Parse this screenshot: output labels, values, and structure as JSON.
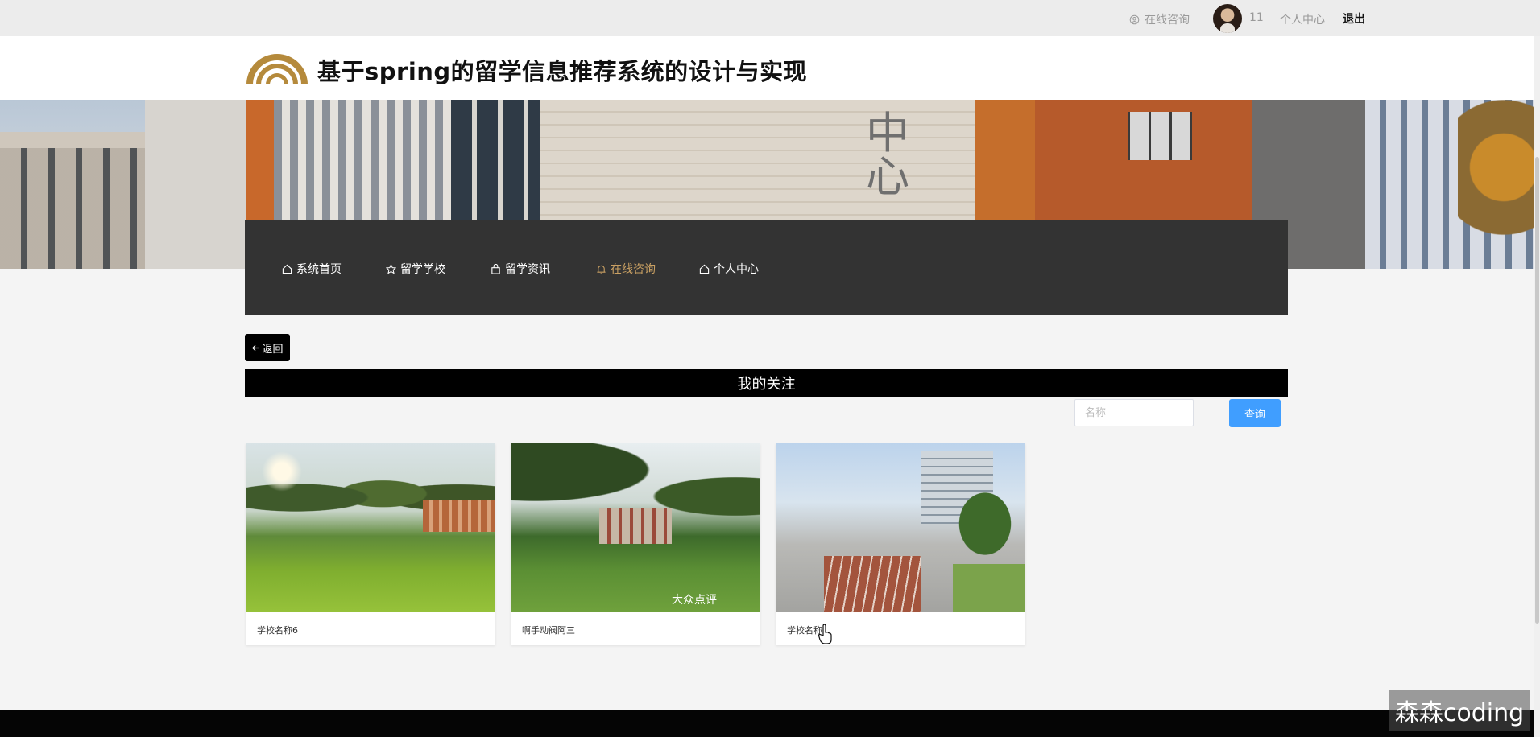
{
  "topbar": {
    "consult_label": "在线咨询",
    "username": "11",
    "center_label": "个人中心",
    "logout_label": "退出"
  },
  "header": {
    "title": "基于spring的留学信息推荐系统的设计与实现"
  },
  "nav": {
    "items": [
      {
        "label": "系统首页",
        "icon": "home-icon"
      },
      {
        "label": "留学学校",
        "icon": "star-icon"
      },
      {
        "label": "留学资讯",
        "icon": "bag-icon"
      },
      {
        "label": "在线咨询",
        "icon": "bell-icon",
        "active": true
      },
      {
        "label": "个人中心",
        "icon": "home-icon"
      }
    ],
    "active_color": "#c9a063"
  },
  "page": {
    "back_label": "返回",
    "section_title": "我的关注"
  },
  "search": {
    "placeholder": "名称",
    "value": "",
    "button_label": "查询"
  },
  "cards": [
    {
      "name": "学校名称6"
    },
    {
      "name": "啊手动阀阿三",
      "image_watermark": "大众点评"
    },
    {
      "name": "学校名称1"
    }
  ],
  "watermark": "森森coding",
  "colors": {
    "primary_button": "#409eff",
    "nav_bg": "#333333",
    "accent_gold": "#b58a3c"
  }
}
